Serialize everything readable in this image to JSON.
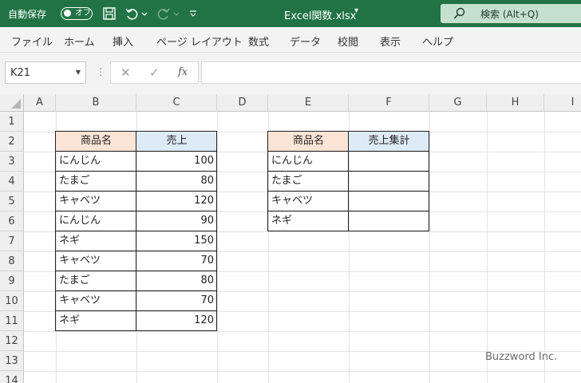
{
  "titlebar": {
    "autosave_label": "自動保存",
    "autosave_state": "オフ",
    "doc_title": "Excel関数.xlsx",
    "doc_caret": "▾",
    "search_text": "検索 (Alt+Q)"
  },
  "ribbon": {
    "tabs": [
      "ファイル",
      "ホーム",
      "挿入",
      "ページ レイアウト",
      "数式",
      "データ",
      "校閲",
      "表示",
      "ヘルプ"
    ]
  },
  "formula_bar": {
    "name_box": "K21",
    "cancel": "✕",
    "enter": "✓",
    "fx": "fx",
    "formula": ""
  },
  "grid": {
    "columns": [
      "A",
      "B",
      "C",
      "D",
      "E",
      "F",
      "G",
      "H",
      "I"
    ],
    "rows": [
      "1",
      "2",
      "3",
      "4",
      "5",
      "6",
      "7",
      "8",
      "9",
      "10",
      "11",
      "12",
      "13",
      "14"
    ]
  },
  "table1": {
    "headers": [
      "商品名",
      "売上"
    ],
    "header_colors": [
      "#fce4d6",
      "#ddebf7"
    ],
    "rows": [
      [
        "にんじん",
        "100"
      ],
      [
        "たまご",
        "80"
      ],
      [
        "キャベツ",
        "120"
      ],
      [
        "にんじん",
        "90"
      ],
      [
        "ネギ",
        "150"
      ],
      [
        "キャベツ",
        "70"
      ],
      [
        "たまご",
        "80"
      ],
      [
        "キャベツ",
        "70"
      ],
      [
        "ネギ",
        "120"
      ]
    ]
  },
  "table2": {
    "headers": [
      "商品名",
      "売上集計"
    ],
    "header_colors": [
      "#fce4d6",
      "#ddebf7"
    ],
    "rows": [
      [
        "にんじん",
        ""
      ],
      [
        "たまご",
        ""
      ],
      [
        "キャベツ",
        ""
      ],
      [
        "ネギ",
        ""
      ]
    ]
  },
  "watermark": "Buzzword Inc.",
  "colors": {
    "titlebar": "#217346",
    "search_box": "#c6e0cf",
    "ribbon_bg": "#f3f3f3"
  }
}
